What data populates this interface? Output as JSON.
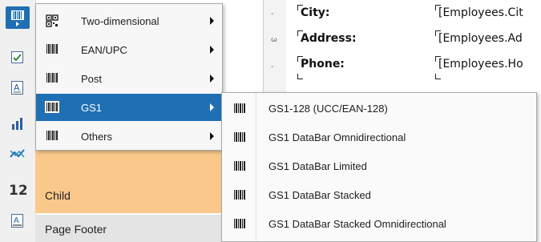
{
  "background": {
    "bands": {
      "child": "Child",
      "page_footer": "Page Footer"
    },
    "ruler": [
      "-",
      "3",
      "-"
    ],
    "fields": [
      {
        "label": "City:",
        "value": "[Employees.Cit"
      },
      {
        "label": "Address:",
        "value": "[Employees.Ad"
      },
      {
        "label": "Phone:",
        "value": "[Employees.Ho"
      }
    ]
  },
  "menu": {
    "items": [
      {
        "label": "Two-dimensional",
        "icon": "qr-code-icon",
        "submenu": true
      },
      {
        "label": "EAN/UPC",
        "icon": "barcode-icon",
        "submenu": true
      },
      {
        "label": "Post",
        "icon": "barcode-icon",
        "submenu": true
      },
      {
        "label": "GS1",
        "icon": "barcode-icon",
        "submenu": true,
        "highlighted": true
      },
      {
        "label": "Others",
        "icon": "barcode-icon",
        "submenu": true
      }
    ]
  },
  "submenu": {
    "items": [
      {
        "label": "GS1-128 (UCC/EAN-128)",
        "icon": "barcode-icon"
      },
      {
        "label": "GS1 DataBar Omnidirectional",
        "icon": "barcode-icon"
      },
      {
        "label": "GS1 DataBar Limited",
        "icon": "barcode-icon"
      },
      {
        "label": "GS1 DataBar Stacked",
        "icon": "barcode-icon"
      },
      {
        "label": "GS1 DataBar Stacked Omnidirectional",
        "icon": "barcode-icon"
      }
    ]
  },
  "colors": {
    "highlight": "#1f6fb4",
    "band": "#f9c88a"
  }
}
